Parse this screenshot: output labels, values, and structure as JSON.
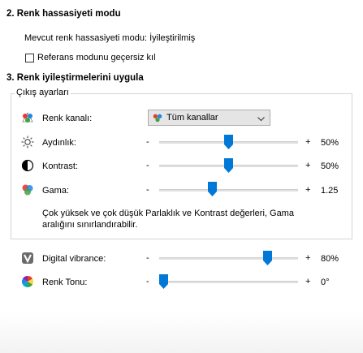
{
  "section2": {
    "title": "2. Renk hassasiyeti modu",
    "current_mode_text": "Mevcut renk hassasiyeti modu: İyileştirilmiş",
    "override_checkbox_label": "Referans modunu geçersiz kıl",
    "override_checked": false
  },
  "section3": {
    "title": "3. Renk iyileştirmelerini uygula",
    "group_label": "Çıkış ayarları",
    "channel": {
      "label": "Renk kanalı:",
      "selected": "Tüm kanallar"
    },
    "sliders": [
      {
        "id": "brightness",
        "label": "Aydınlık:",
        "minus": "-",
        "plus": "+",
        "value_text": "50%",
        "value": 0.5
      },
      {
        "id": "contrast",
        "label": "Kontrast:",
        "minus": "-",
        "plus": "+",
        "value_text": "50%",
        "value": 0.5
      },
      {
        "id": "gamma",
        "label": "Gama:",
        "minus": "-",
        "plus": "+",
        "value_text": "1.25",
        "value": 0.375
      }
    ],
    "note_line1": "Çok yüksek ve çok düşük Parlaklık ve Kontrast değerleri, Gama",
    "note_line2": "aralığını sınırlandırabilir.",
    "vibrance": {
      "label": "Digital vibrance:",
      "minus": "-",
      "plus": "+",
      "value_text": "80%",
      "value": 0.8
    },
    "hue": {
      "label": "Renk Tonu:",
      "minus": "-",
      "plus": "+",
      "value_text": "0°",
      "value": 0.0
    }
  },
  "colors": {
    "accent": "#0078d7",
    "group_border": "#d4d4d4",
    "dropdown_bg": "#e5e5e5"
  },
  "icons": {
    "channel": "rgb-triangle-icon",
    "brightness": "sun-icon",
    "contrast": "contrast-circle-icon",
    "gamma": "rgb-circles-icon",
    "vibrance": "vibrance-icon",
    "hue": "color-wheel-icon"
  }
}
